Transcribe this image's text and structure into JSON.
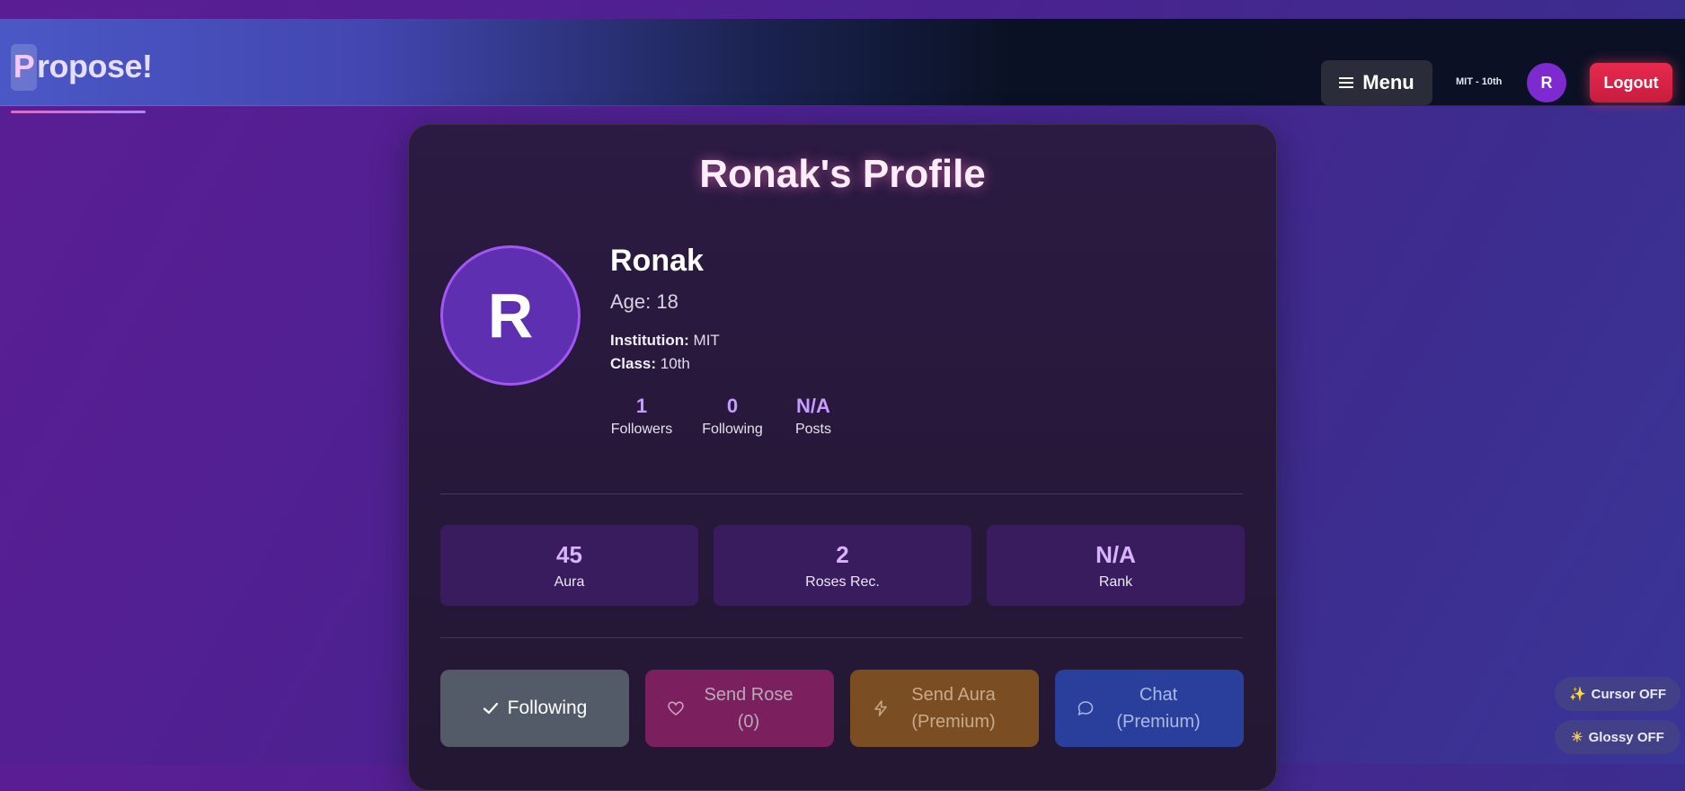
{
  "nav": {
    "brand_first": "P",
    "brand_rest": "ropose!",
    "menu_label": "Menu",
    "institution_class": "MIT - 10th",
    "avatar_initial": "R",
    "logout_label": "Logout"
  },
  "profile": {
    "title": "Ronak's Profile",
    "avatar_initial": "R",
    "name": "Ronak",
    "age": "Age: 18",
    "institution_label": "Institution:",
    "institution_value": "MIT",
    "class_label": "Class:",
    "class_value": "10th",
    "stats": [
      {
        "value": "1",
        "label": "Followers"
      },
      {
        "value": "0",
        "label": "Following"
      },
      {
        "value": "N/A",
        "label": "Posts"
      }
    ]
  },
  "metrics": [
    {
      "value": "45",
      "label": "Aura"
    },
    {
      "value": "2",
      "label": "Roses Rec."
    },
    {
      "value": "N/A",
      "label": "Rank"
    }
  ],
  "actions": {
    "following": "Following",
    "send_rose_line1": "Send Rose",
    "send_rose_line2": "(0)",
    "send_aura_line1": "Send Aura",
    "send_aura_line2": "(Premium)",
    "chat_line1": "Chat",
    "chat_line2": "(Premium)"
  },
  "toggles": {
    "cursor": "Cursor OFF",
    "glossy": "Glossy OFF"
  },
  "colors": {
    "accent": "#7e2ad1",
    "logout": "#e8294e",
    "stat_value": "#c79bff"
  }
}
